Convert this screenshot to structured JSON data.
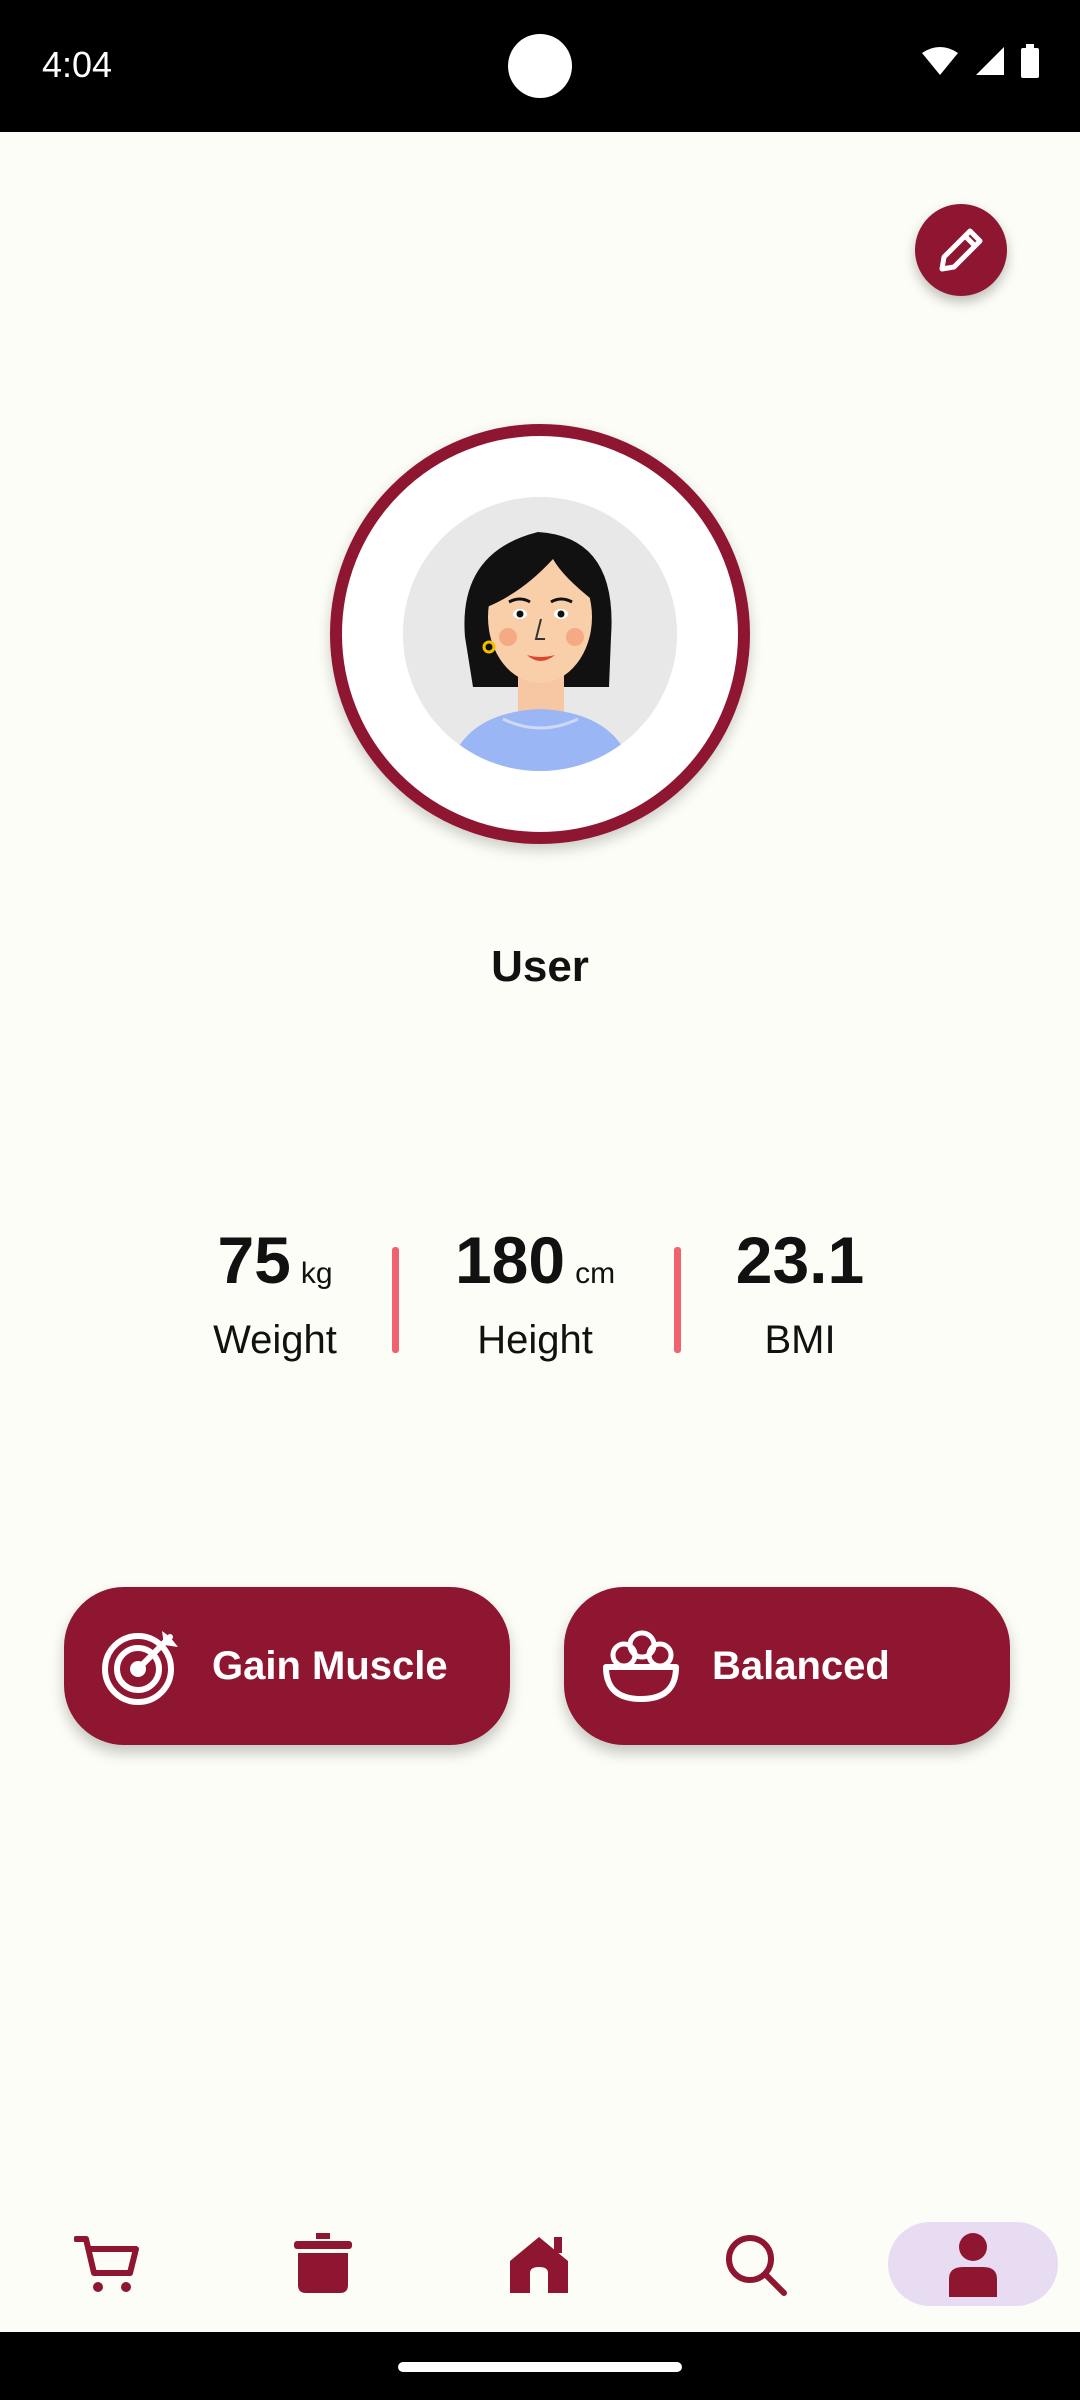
{
  "status_bar": {
    "time": "4:04"
  },
  "profile": {
    "name": "User",
    "edit_icon": "pencil-icon"
  },
  "stats": {
    "weight": {
      "value": "75",
      "unit": "kg",
      "label": "Weight"
    },
    "height": {
      "value": "180",
      "unit": "cm",
      "label": "Height"
    },
    "bmi": {
      "value": "23.1",
      "label": "BMI"
    }
  },
  "goals": {
    "primary": {
      "label": "Gain Muscle",
      "icon": "target-icon"
    },
    "diet": {
      "label": "Balanced",
      "icon": "salad-bowl-icon"
    }
  },
  "bottom_nav": {
    "items": [
      {
        "icon": "cart-icon",
        "active": false
      },
      {
        "icon": "pot-icon",
        "active": false
      },
      {
        "icon": "home-icon",
        "active": false
      },
      {
        "icon": "search-icon",
        "active": false
      },
      {
        "icon": "profile-icon",
        "active": true
      }
    ]
  },
  "colors": {
    "accent": "#8f1631",
    "divider": "#f0626d",
    "background": "#fdfdf7",
    "active_nav": "#e8dcf2"
  }
}
